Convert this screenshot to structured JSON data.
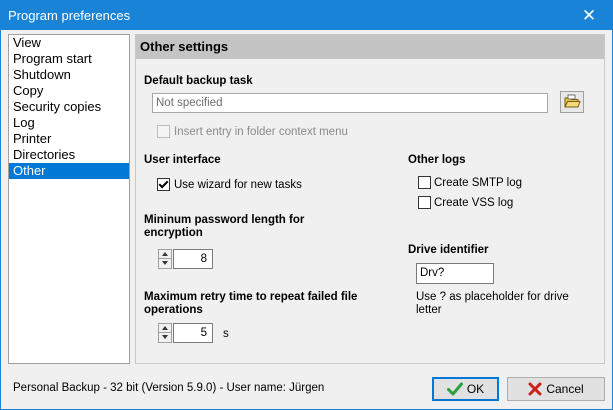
{
  "window": {
    "title": "Program preferences"
  },
  "sidebar": {
    "items": [
      {
        "label": "View"
      },
      {
        "label": "Program start"
      },
      {
        "label": "Shutdown"
      },
      {
        "label": "Copy"
      },
      {
        "label": "Security copies"
      },
      {
        "label": "Log"
      },
      {
        "label": "Printer"
      },
      {
        "label": "Directories"
      },
      {
        "label": "Other",
        "selected": true
      }
    ]
  },
  "panel": {
    "title": "Other settings",
    "default_backup": {
      "label": "Default backup task",
      "value": "Not specified",
      "context_menu_label": "Insert entry in folder context menu",
      "context_menu_checked": false,
      "context_menu_enabled": false
    },
    "user_interface": {
      "label": "User interface",
      "wizard_label": "Use wizard for new tasks",
      "wizard_checked": true
    },
    "password": {
      "label_line1": "Mininum password length for",
      "label_line2": "encryption",
      "value": "8"
    },
    "retry": {
      "label_line1": "Maximum retry time to repeat failed file",
      "label_line2": "operations",
      "value": "5",
      "unit": "s"
    },
    "other_logs": {
      "label": "Other logs",
      "smtp_label": "Create SMTP log",
      "smtp_checked": false,
      "vss_label": "Create VSS log",
      "vss_checked": false
    },
    "drive_identifier": {
      "label": "Drive identifier",
      "value": "Drv?",
      "hint_line1": "Use ? as placeholder for drive",
      "hint_line2": "letter"
    }
  },
  "footer": {
    "status": "Personal Backup - 32 bit (Version 5.9.0) - User name: Jürgen",
    "ok_label": "OK",
    "cancel_label": "Cancel"
  },
  "icons": {
    "close": "close-icon",
    "browse": "folder-icon",
    "ok": "checkmark-icon",
    "cancel": "x-icon"
  },
  "colors": {
    "titlebar": "#1883d7",
    "selection": "#0078d7",
    "header_band": "#c4c4c4",
    "ok_check": "#2ea043",
    "cancel_x": "#c8201b"
  }
}
